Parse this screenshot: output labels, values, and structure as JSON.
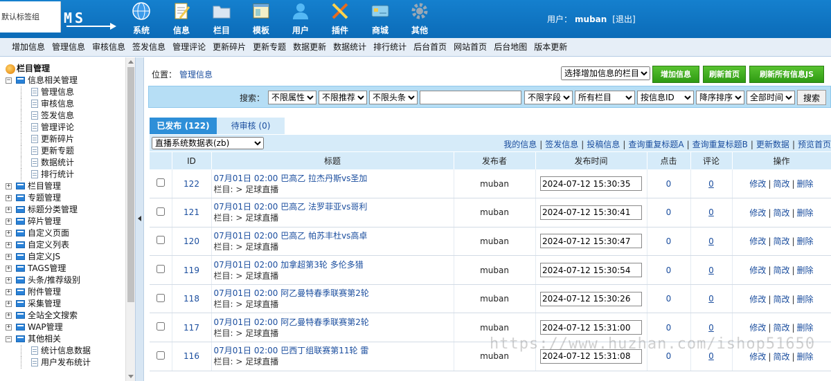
{
  "header": {
    "tag_group": "默认标签组",
    "logo_text": "MS",
    "modules": [
      {
        "label": "系统",
        "icon": "globe-icon",
        "color": "#3c9bea"
      },
      {
        "label": "信息",
        "icon": "document-edit-icon",
        "color": "#f2c94c"
      },
      {
        "label": "栏目",
        "icon": "folder-icon",
        "color": "#dbe6f2"
      },
      {
        "label": "模板",
        "icon": "template-window-icon",
        "color": "#f5f0c8"
      },
      {
        "label": "用户",
        "icon": "user-icon",
        "color": "#54b8f5"
      },
      {
        "label": "插件",
        "icon": "plugin-tools-icon",
        "color": "#e66b1e"
      },
      {
        "label": "商城",
        "icon": "card-icon",
        "color": "#8fd0ef"
      },
      {
        "label": "其他",
        "icon": "gear-icon",
        "color": "#9aa8b5"
      }
    ],
    "user_label": "用户：",
    "username": "muban",
    "logout": "[退出]"
  },
  "quick_menu": [
    "增加信息",
    "管理信息",
    "审核信息",
    "签发信息",
    "管理评论",
    "更新碎片",
    "更新专题",
    "数据更新",
    "数据统计",
    "排行统计",
    "后台首页",
    "网站首页",
    "后台地图",
    "版本更新"
  ],
  "sidebar": {
    "root": "栏目管理",
    "groups": [
      {
        "label": "信息相关管理",
        "expanded": true,
        "children": [
          "管理信息",
          "审核信息",
          "签发信息",
          "管理评论",
          "更新碎片",
          "更新专题",
          "数据统计",
          "排行统计"
        ]
      },
      {
        "label": "栏目管理",
        "expanded": false,
        "children": []
      },
      {
        "label": "专题管理",
        "expanded": false,
        "children": []
      },
      {
        "label": "标题分类管理",
        "expanded": false,
        "children": []
      },
      {
        "label": "碎片管理",
        "expanded": false,
        "children": []
      },
      {
        "label": "自定义页面",
        "expanded": false,
        "children": []
      },
      {
        "label": "自定义列表",
        "expanded": false,
        "children": []
      },
      {
        "label": "自定义JS",
        "expanded": false,
        "children": []
      },
      {
        "label": "TAGS管理",
        "expanded": false,
        "children": []
      },
      {
        "label": "头条/推荐级别",
        "expanded": false,
        "children": []
      },
      {
        "label": "附件管理",
        "expanded": false,
        "children": []
      },
      {
        "label": "采集管理",
        "expanded": false,
        "children": []
      },
      {
        "label": "全站全文搜索",
        "expanded": false,
        "children": []
      },
      {
        "label": "WAP管理",
        "expanded": false,
        "children": []
      },
      {
        "label": "其他相关",
        "expanded": true,
        "children": [
          "统计信息数据",
          "用户发布统计"
        ]
      }
    ]
  },
  "main": {
    "position_label": "位置：",
    "position_link": "管理信息",
    "column_select": "选择增加信息的栏目",
    "buttons": {
      "add": "增加信息",
      "refresh_home": "刷新首页",
      "refresh_all": "刷新所有信息JS"
    },
    "search": {
      "label": "搜索：",
      "attr": "不限属性",
      "recommend": "不限推荐",
      "headline": "不限头条",
      "keyword": "",
      "field": "不限字段",
      "column": "所有栏目",
      "order_by": "按信息ID",
      "order": "降序排序",
      "time": "全部时间",
      "button": "搜索"
    },
    "tabs": {
      "published": "已发布 (122)",
      "pending": "待审核 (0)"
    },
    "table_select": "直播系统数据表(zb)",
    "toolbar_links": [
      "我的信息",
      "签发信息",
      "投稿信息",
      "查询重复标题A",
      "查询重复标题B",
      "更新数据",
      "预览首页"
    ],
    "columns": {
      "id": "ID",
      "title": "标题",
      "publisher": "发布者",
      "time": "发布时间",
      "clicks": "点击",
      "comments": "评论",
      "ops": "操作"
    },
    "ops": {
      "edit": "修改",
      "quick_edit": "简改",
      "delete": "删除"
    },
    "rows": [
      {
        "id": "122",
        "title": "07月01日 02:00 巴高乙 拉杰丹斯vs圣加",
        "sub": "栏目: > 足球直播",
        "publisher": "muban",
        "time": "2024-07-12 15:30:35",
        "clicks": "0",
        "comments": "0"
      },
      {
        "id": "121",
        "title": "07月01日 02:00 巴高乙 法罗菲亚vs哥利",
        "sub": "栏目: > 足球直播",
        "publisher": "muban",
        "time": "2024-07-12 15:30:41",
        "clicks": "0",
        "comments": "0"
      },
      {
        "id": "120",
        "title": "07月01日 02:00 巴高乙 帕苏丰杜vs高卓",
        "sub": "栏目: > 足球直播",
        "publisher": "muban",
        "time": "2024-07-12 15:30:47",
        "clicks": "0",
        "comments": "0"
      },
      {
        "id": "119",
        "title": "07月01日 02:00 加拿超第3轮 多伦多猎",
        "sub": "栏目: > 足球直播",
        "publisher": "muban",
        "time": "2024-07-12 15:30:54",
        "clicks": "0",
        "comments": "0"
      },
      {
        "id": "118",
        "title": "07月01日 02:00 阿乙曼特春季联赛第2轮",
        "sub": "栏目: > 足球直播",
        "publisher": "muban",
        "time": "2024-07-12 15:30:26",
        "clicks": "0",
        "comments": "0"
      },
      {
        "id": "117",
        "title": "07月01日 02:00 阿乙曼特春季联赛第2轮",
        "sub": "栏目: > 足球直播",
        "publisher": "muban",
        "time": "2024-07-12 15:31:00",
        "clicks": "0",
        "comments": "0"
      },
      {
        "id": "116",
        "title": "07月01日 02:00 巴西丁组联赛第11轮 雷",
        "sub": "栏目: > 足球直播",
        "publisher": "muban",
        "time": "2024-07-12 15:31:08",
        "clicks": "0",
        "comments": "0"
      }
    ]
  },
  "watermark": "https://www.huzhan.com/ishop51650"
}
